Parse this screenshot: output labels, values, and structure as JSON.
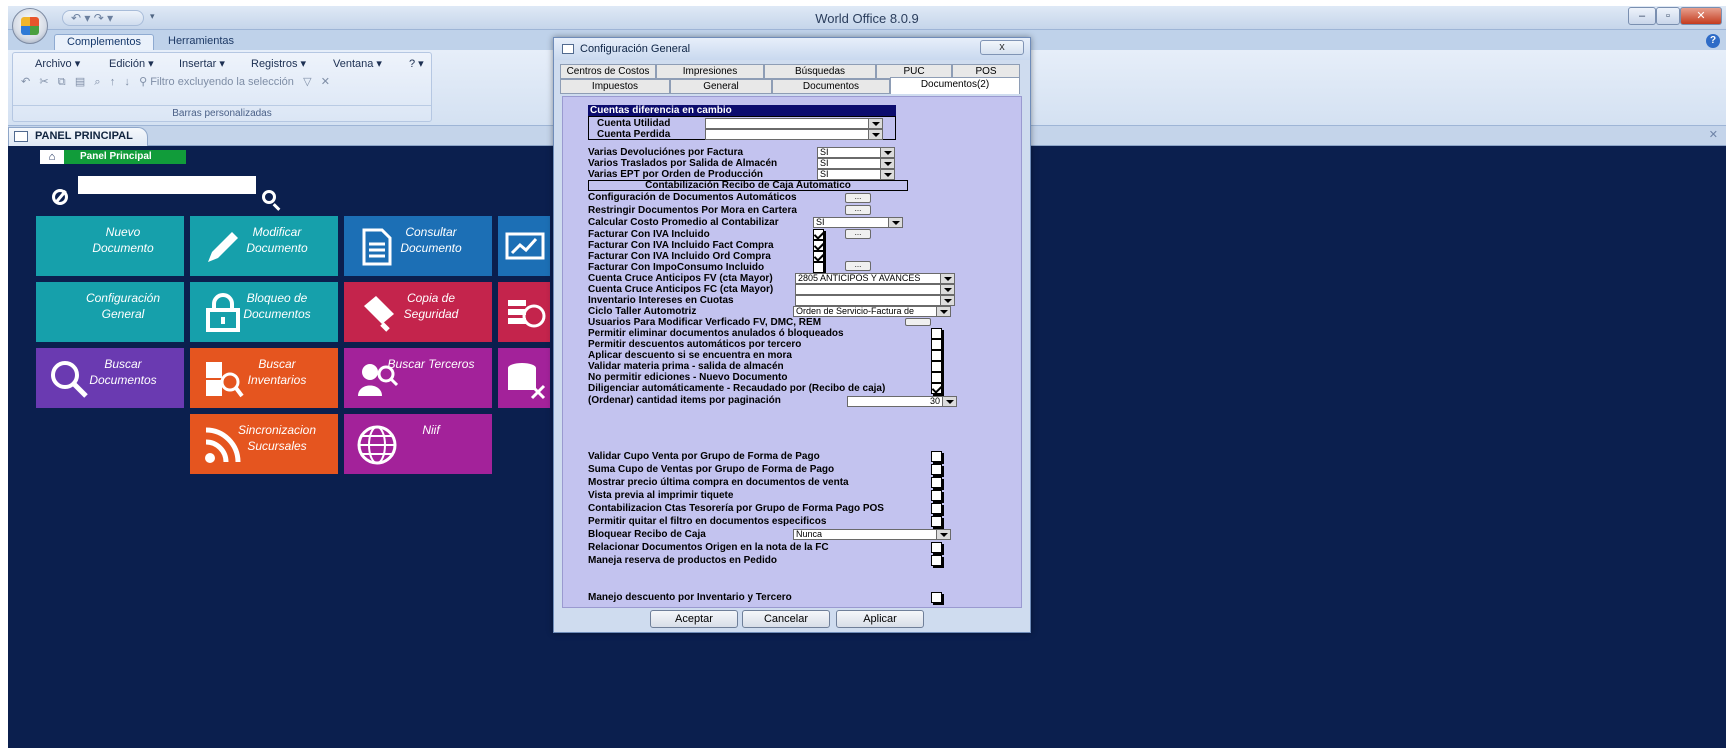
{
  "app": {
    "title": "World Office 8.0.9",
    "qat": "↶ ▾ ↷ ▾"
  },
  "ribbon": {
    "tabs": [
      "Complementos",
      "Herramientas"
    ],
    "menus": [
      "Archivo",
      "Edición",
      "Insertar",
      "Registros",
      "Ventana",
      "?"
    ],
    "filter_label": "Filtro excluyendo la selección",
    "group_label": "Barras personalizadas"
  },
  "doc_tab": {
    "label": "PANEL PRINCIPAL"
  },
  "panel": {
    "breadcrumb": "Panel Principal",
    "search_value": ""
  },
  "tiles": [
    {
      "label": "Nuevo Documento",
      "color": "#16a0ab",
      "icon": "new-document-icon"
    },
    {
      "label": "Modificar Documento",
      "color": "#16a0ab",
      "icon": "pencil-icon"
    },
    {
      "label": "Consultar Documento",
      "color": "#1c6fb5",
      "icon": "document-icon"
    },
    {
      "label": "",
      "color": "#1c6fb5",
      "icon": "chart-icon"
    },
    {
      "label": "Configuración General",
      "color": "#16a0ab",
      "icon": "settings-icon"
    },
    {
      "label": "Bloqueo de Documentos",
      "color": "#16a0ab",
      "icon": "lock-icon"
    },
    {
      "label": "Copia de Seguridad",
      "color": "#c4244c",
      "icon": "usb-icon"
    },
    {
      "label": "",
      "color": "#c4244c",
      "icon": "money-icon"
    },
    {
      "label": "Buscar Documentos",
      "color": "#6a3ab1",
      "icon": "search-icon"
    },
    {
      "label": "Buscar Inventarios",
      "color": "#e5551f",
      "icon": "inventory-search-icon"
    },
    {
      "label": "Buscar Terceros",
      "color": "#a3229a",
      "icon": "user-search-icon"
    },
    {
      "label": "",
      "color": "#a3229a",
      "icon": "database-icon"
    },
    {
      "label": "Sincronizacion Sucursales",
      "color": "#e5551f",
      "icon": "rss-icon"
    },
    {
      "label": "Niif",
      "color": "#a3229a",
      "icon": "globe-icon"
    }
  ],
  "dialog": {
    "title": "Configuración General",
    "close": "x",
    "tabs_row1": [
      "Centros de Costos",
      "Impresiones",
      "Búsquedas",
      "PUC",
      "POS"
    ],
    "tabs_row2": [
      "Impuestos",
      "General",
      "Documentos",
      "Documentos(2)"
    ],
    "header1": "Cuentas diferencia en cambio",
    "cuenta_utilidad": "Cuenta Utilidad",
    "cuenta_perdida": "Cuenta Perdida",
    "header2": "Contabilización Recibo de Caja Automatico",
    "rows": {
      "varias_devoluciones": "Varias Devoluciónes por Factura",
      "varios_traslados": "Varios Traslados por Salida de Almacén",
      "varias_ept": "Varias EPT por Orden de Producción",
      "config_docs_auto": "Configuración de Documentos Automáticos",
      "restringir": "Restringir Documentos Por Mora en Cartera",
      "calcular_costo": "Calcular Costo Promedio al Contabilizar",
      "iva_incluido": "Facturar Con IVA Incluido",
      "iva_fact_compra": "Facturar Con IVA Incluido Fact Compra",
      "iva_ord_compra": "Facturar Con IVA Incluido Ord Compra",
      "impoconsumo": "Facturar Con ImpoConsumo Incluido",
      "cruce_fv": "Cuenta Cruce Anticipos FV (cta Mayor)",
      "cruce_fc": "Cuenta Cruce Anticipos FC (cta Mayor)",
      "inventario_intereses": "Inventario Intereses en Cuotas",
      "ciclo_taller": "Ciclo Taller Automotriz",
      "usuarios_modificar": "Usuarios Para Modificar Verficado FV, DMC, REM",
      "eliminar_anulados": "Permitir eliminar documentos anulados ó bloqueados",
      "descuentos_tercero": "Permitir descuentos automáticos por tercero",
      "descuento_mora": "Aplicar descuento si se encuentra en mora",
      "materia_prima": "Validar materia prima - salida de almacén",
      "no_ediciones": "No permitir ediciones - Nuevo Documento",
      "diligenciar": "Diligenciar automáticamente - Recaudado por (Recibo de caja)",
      "ordenar": "(Ordenar) cantidad items por paginación",
      "validar_cupo": "Validar Cupo Venta por Grupo de Forma de Pago",
      "suma_cupo": "Suma Cupo de Ventas por Grupo de Forma de Pago",
      "mostrar_precio": "Mostrar precio última compra en documentos de venta",
      "vista_previa": "Vista previa al imprimir tiquete",
      "contabilizacion_ctas": "Contabilizacion Ctas Tesorería por Grupo de Forma Pago POS",
      "quitar_filtro": "Permitir quitar el filtro en documentos especificos",
      "bloquear_recibo": "Bloquear Recibo de Caja",
      "relacionar_docs": "Relacionar Documentos Origen en la nota de la FC",
      "maneja_reserva": "Maneja reserva de productos en Pedido",
      "manejo_descuento": "Manejo descuento por Inventario y Tercero"
    },
    "values": {
      "si": "SI",
      "cruce_fv": "2805 ANTICIPOS Y AVANCES",
      "ciclo_taller": "Orden de Servicio-Factura de",
      "ordenar": "30",
      "bloquear_recibo": "Nunca",
      "dots": "..."
    },
    "buttons": {
      "aceptar": "Aceptar",
      "cancelar": "Cancelar",
      "aplicar": "Aplicar"
    }
  }
}
